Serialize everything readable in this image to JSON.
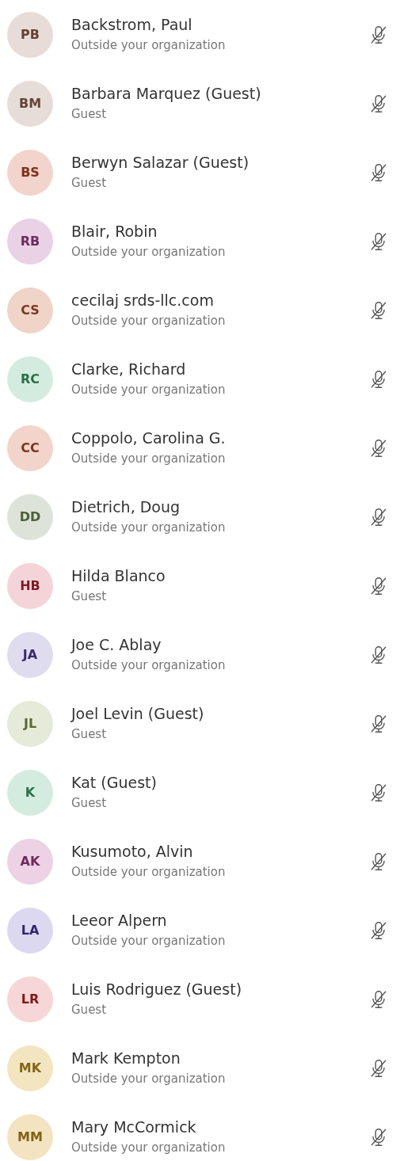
{
  "participants": [
    {
      "initials": "PB",
      "name": "Backstrom, Paul",
      "subtitle": "Outside your organization",
      "color": "#e8dcd8",
      "muted": true
    },
    {
      "initials": "BM",
      "name": "Barbara Marquez (Guest)",
      "subtitle": "Guest",
      "color": "#e6ddd9",
      "muted": true
    },
    {
      "initials": "BS",
      "name": "Berwyn Salazar (Guest)",
      "subtitle": "Guest",
      "color": "#f2d4cc",
      "muted": true
    },
    {
      "initials": "RB",
      "name": "Blair, Robin",
      "subtitle": "Outside your organization",
      "color": "#ead2e6",
      "muted": true
    },
    {
      "initials": "CS",
      "name": "cecilaj srds-llc.com",
      "subtitle": "Outside your organization",
      "color": "#f0d4c8",
      "muted": true
    },
    {
      "initials": "RC",
      "name": "Clarke, Richard",
      "subtitle": "Outside your organization",
      "color": "#d4ecdf",
      "muted": true
    },
    {
      "initials": "CC",
      "name": "Coppolo, Carolina G.",
      "subtitle": "Outside your organization",
      "color": "#f2d4ca",
      "muted": true
    },
    {
      "initials": "DD",
      "name": "Dietrich, Doug",
      "subtitle": "Outside your organization",
      "color": "#dde3d8",
      "muted": true
    },
    {
      "initials": "HB",
      "name": "Hilda Blanco",
      "subtitle": "Guest",
      "color": "#f4d4d8",
      "muted": true
    },
    {
      "initials": "JA",
      "name": "Joe C. Ablay",
      "subtitle": "Outside your organization",
      "color": "#e0dcef",
      "muted": true
    },
    {
      "initials": "JL",
      "name": "Joel Levin (Guest)",
      "subtitle": "Guest",
      "color": "#e5ead9",
      "muted": true
    },
    {
      "initials": "K",
      "name": "Kat (Guest)",
      "subtitle": "Guest",
      "color": "#d4ecdf",
      "muted": true
    },
    {
      "initials": "AK",
      "name": "Kusumoto, Alvin",
      "subtitle": "Outside your organization",
      "color": "#ecd2e4",
      "muted": true
    },
    {
      "initials": "LA",
      "name": "Leeor Alpern",
      "subtitle": "Outside your organization",
      "color": "#dcd8f0",
      "muted": true
    },
    {
      "initials": "LR",
      "name": "Luis Rodriguez (Guest)",
      "subtitle": "Guest",
      "color": "#f6d6d6",
      "muted": true
    },
    {
      "initials": "MK",
      "name": "Mark Kempton",
      "subtitle": "Outside your organization",
      "color": "#f3e5c0",
      "muted": true
    },
    {
      "initials": "MM",
      "name": "Mary McCormick",
      "subtitle": "Outside your organization",
      "color": "#f3e3c0",
      "muted": true
    }
  ]
}
